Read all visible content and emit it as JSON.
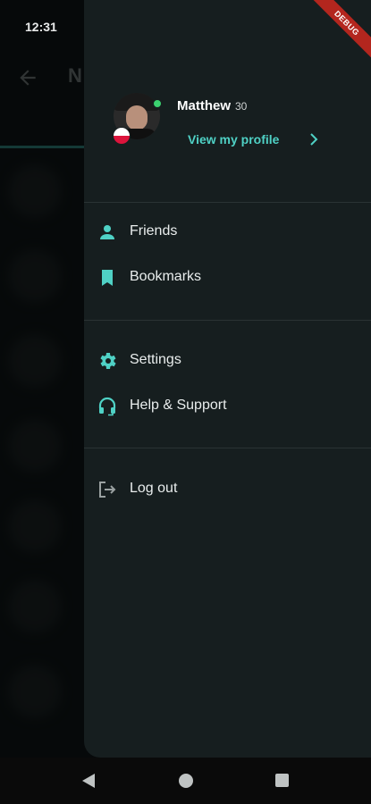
{
  "status_bar": {
    "time": "12:31",
    "debug_banner": "DEBUG"
  },
  "background": {
    "title_initial": "N"
  },
  "drawer": {
    "profile": {
      "name": "Matthew",
      "age": "30",
      "view_profile_label": "View my profile",
      "online": true,
      "flag": "poland"
    },
    "menu_groups": [
      [
        {
          "label": "Friends",
          "icon": "person-icon"
        },
        {
          "label": "Bookmarks",
          "icon": "bookmark-icon"
        }
      ],
      [
        {
          "label": "Settings",
          "icon": "gear-icon"
        },
        {
          "label": "Help & Support",
          "icon": "headset-icon"
        }
      ],
      [
        {
          "label": "Log out",
          "icon": "logout-icon"
        }
      ]
    ]
  },
  "colors": {
    "accent": "#4fd1c5",
    "drawer_bg": "#161e1f",
    "online": "#3bd16f"
  }
}
